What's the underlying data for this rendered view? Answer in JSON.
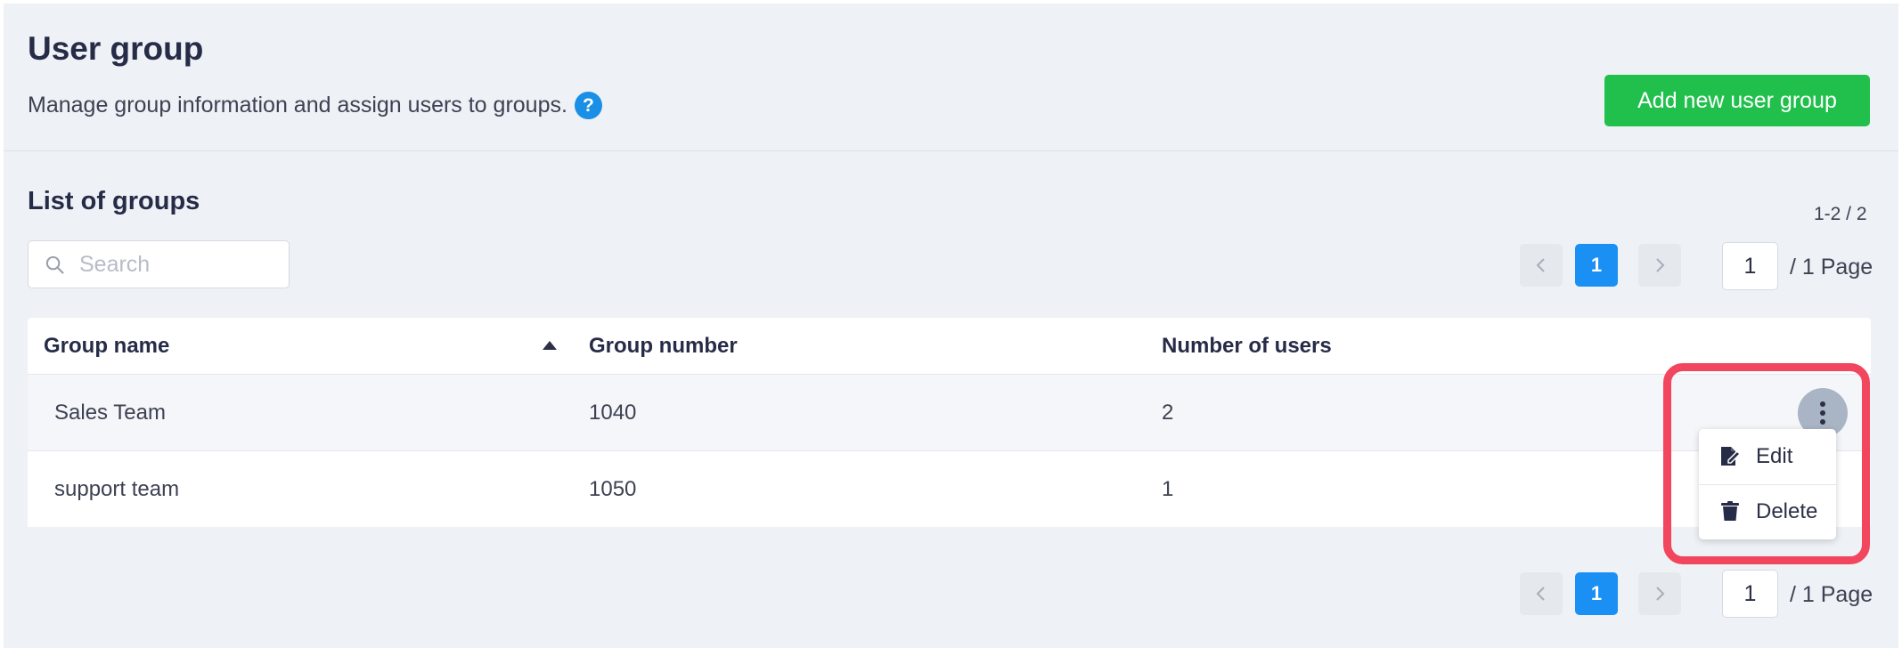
{
  "header": {
    "title": "User group",
    "subtitle": "Manage group information and assign users to groups.",
    "help_icon": "question-circle-icon",
    "add_button_label": "Add new user group"
  },
  "list": {
    "section_title": "List of groups",
    "range_text": "1-2 / 2",
    "search_placeholder": "Search",
    "search_value": ""
  },
  "pagination": {
    "current_page": "1",
    "page_input_value": "1",
    "total_pages_text": "/ 1 Page",
    "prev_icon": "chevron-left-icon",
    "next_icon": "chevron-right-icon"
  },
  "table": {
    "columns": [
      "Group name",
      "Group number",
      "Number of users"
    ],
    "sort_column": "Group name",
    "sort_direction": "ascending",
    "rows": [
      {
        "group_name": "Sales Team",
        "group_number": "1040",
        "number_of_users": "2"
      },
      {
        "group_name": "support team",
        "group_number": "1050",
        "number_of_users": "1"
      }
    ]
  },
  "row_menu": {
    "trigger_icon": "more-vertical-icon",
    "items": [
      {
        "label": "Edit",
        "icon": "edit-icon"
      },
      {
        "label": "Delete",
        "icon": "trash-icon"
      }
    ]
  },
  "colors": {
    "accent_green": "#21c04d",
    "accent_blue": "#1a90f5",
    "highlight_red": "#f2455e",
    "background": "#eef1f5"
  }
}
